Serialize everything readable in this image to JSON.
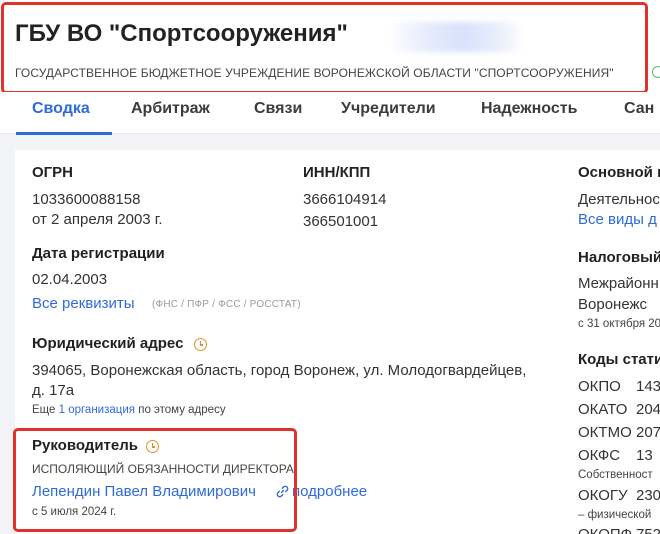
{
  "header": {
    "title": "ГБУ ВО \"Спортсооружения\"",
    "full_name": "ГОСУДАРСТВЕННОЕ БЮДЖЕТНОЕ УЧРЕЖДЕНИЕ ВОРОНЕЖСКОЙ ОБЛАСТИ \"СПОРТСООРУЖЕНИЯ\""
  },
  "tabs": [
    {
      "label": "Сводка",
      "active": true
    },
    {
      "label": "Арбитраж"
    },
    {
      "label": "Связи"
    },
    {
      "label": "Учредители"
    },
    {
      "label": "Надежность"
    },
    {
      "label": "Сан"
    }
  ],
  "col1": {
    "ogrn_label": "ОГРН",
    "ogrn_value": "1033600088158",
    "ogrn_date": "от 2 апреля 2003 г.",
    "reg_label": "Дата регистрации",
    "reg_value": "02.04.2003",
    "all_details_link": "Все реквизиты",
    "all_details_note": "(ФНС / ПФР / ФСС / РОССТАТ)",
    "address_label": "Юридический адрес",
    "address_line1": "394065, Воронежская область, город Воронеж, ул. Молодогвардейцев,",
    "address_line2": "д. 17а",
    "address_more_pre": "Еще",
    "address_more_link": "1 организация",
    "address_more_post": "по этому адресу",
    "manager_label": "Руководитель",
    "manager_role": "ИСПОЛЯЮЩИЙ ОБЯЗАННОСТИ ДИРЕКТОРА",
    "manager_name": "Лепендин Павел Владимирович",
    "manager_more": "подробнее",
    "manager_since": "с 5 июля 2024 г."
  },
  "col2": {
    "inn_label": "ИНН/КПП",
    "inn_value": "3666104914",
    "kpp_value": "366501001"
  },
  "col3": {
    "main_label": "Основной в",
    "main_value": "Деятельнос",
    "main_link": "Все виды д",
    "tax_label": "Налоговый",
    "tax_line1": "Межрайонн",
    "tax_line2": "Воронежс",
    "tax_since": "с 31 октября 20",
    "codes_label": "Коды стати",
    "codes": [
      {
        "name": "ОКПО",
        "value": "143"
      },
      {
        "name": "ОКАТО",
        "value": "204"
      },
      {
        "name": "ОКТМО",
        "value": "207"
      },
      {
        "name": "ОКФС",
        "value": "13"
      }
    ],
    "okfs_note": "Собственност",
    "okogu_name": "ОКОГУ",
    "okogu_value": "230",
    "okogu_note": "– физической",
    "okopf_name": "ОКОПФ",
    "okopf_value": "752"
  }
}
